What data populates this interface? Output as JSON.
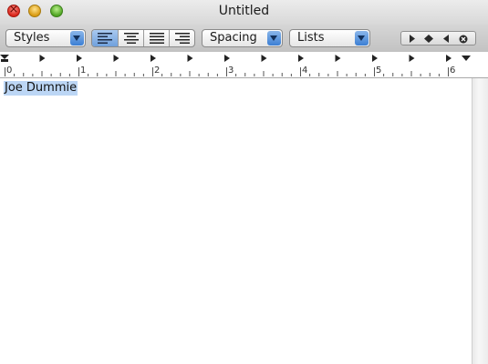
{
  "window": {
    "title": "Untitled"
  },
  "toolbar": {
    "styles_label": "Styles",
    "alignment": [
      "align-left",
      "align-center",
      "align-justify",
      "align-right"
    ],
    "alignment_selected": "align-left",
    "spacing_label": "Spacing",
    "lists_label": "Lists",
    "nav_icons": [
      "play-right-icon",
      "diamond-icon",
      "play-left-icon",
      "circle-x-icon"
    ]
  },
  "ruler": {
    "numbers": [
      "0",
      "1",
      "2",
      "3",
      "4",
      "5",
      "6"
    ]
  },
  "document": {
    "text": "Joe Dummie"
  },
  "colors": {
    "selection": "#bcd6f5",
    "popup_arrow": "#3c7fd4",
    "toolbar": "#c8c8c8"
  }
}
